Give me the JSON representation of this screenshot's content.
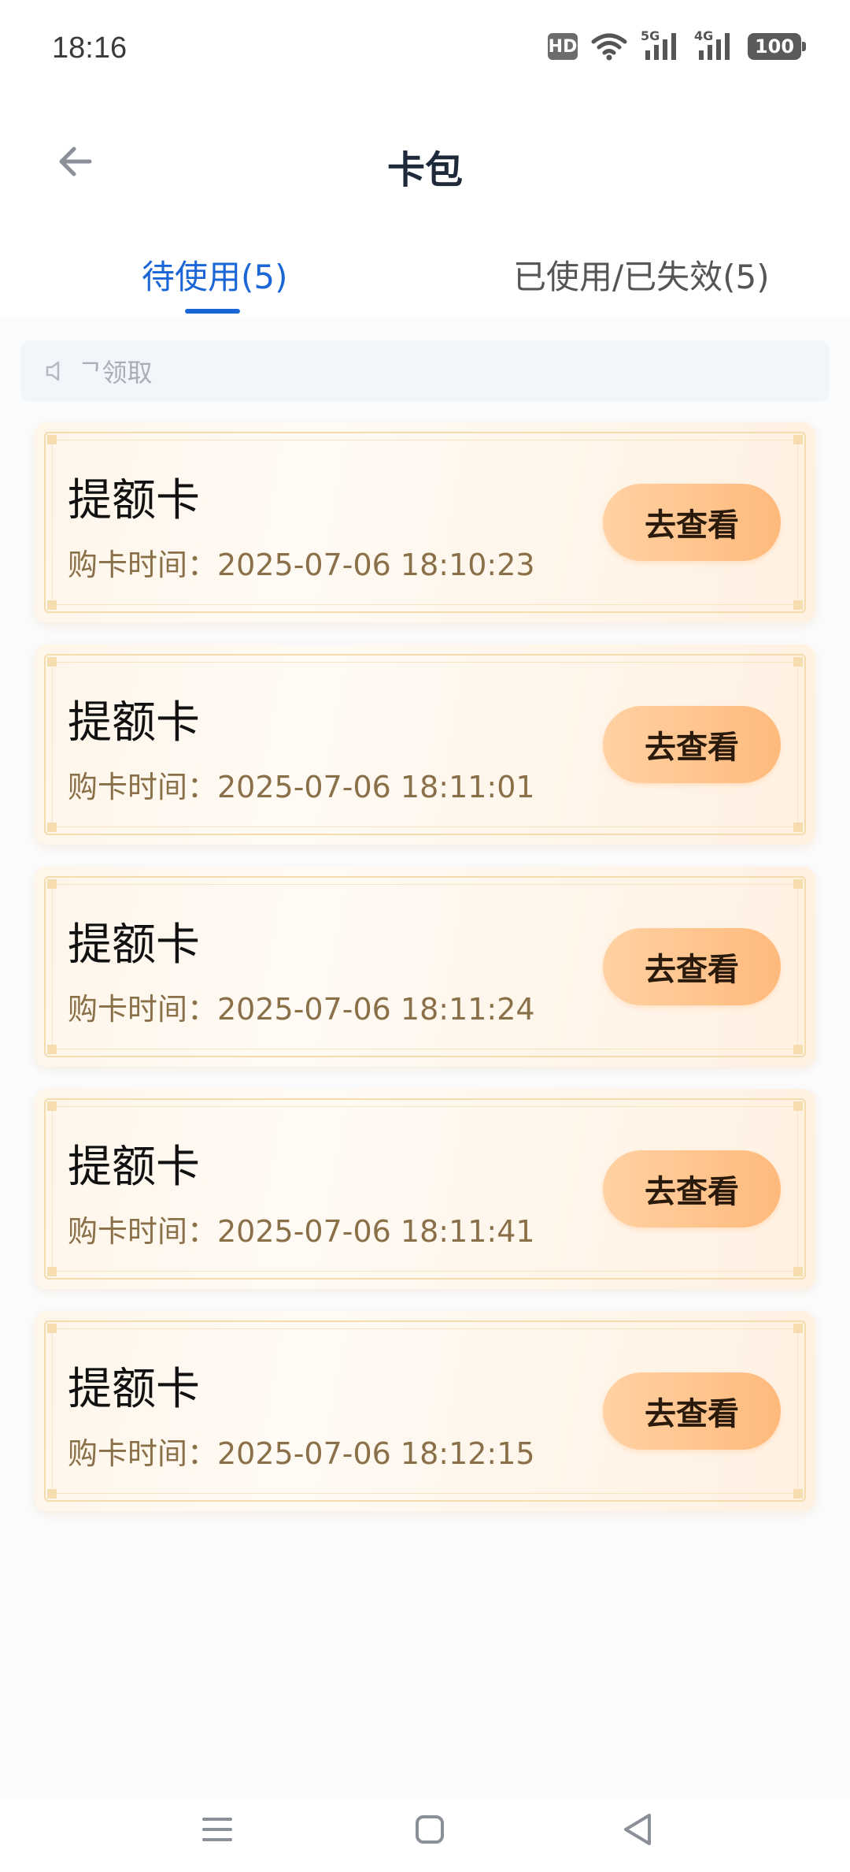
{
  "status_bar": {
    "time": "18:16",
    "hd_label": "HD",
    "network_5g": "5G",
    "network_4g": "4G",
    "battery": "100"
  },
  "header": {
    "title": "卡包"
  },
  "tabs": [
    {
      "label": "待使用(5)",
      "active": true
    },
    {
      "label": "已使用/已失效(5)",
      "active": false
    }
  ],
  "notice": {
    "text": "ᄀ领取"
  },
  "cards": [
    {
      "title": "提额卡",
      "time": "购卡时间：2025-07-06 18:10:23",
      "button": "去查看"
    },
    {
      "title": "提额卡",
      "time": "购卡时间：2025-07-06 18:11:01",
      "button": "去查看"
    },
    {
      "title": "提额卡",
      "time": "购卡时间：2025-07-06 18:11:24",
      "button": "去查看"
    },
    {
      "title": "提额卡",
      "time": "购卡时间：2025-07-06 18:11:41",
      "button": "去查看"
    },
    {
      "title": "提额卡",
      "time": "购卡时间：2025-07-06 18:12:15",
      "button": "去查看"
    }
  ],
  "colors": {
    "accent": "#1a66d6",
    "button_from": "#ffd1a3",
    "button_to": "#ffba7c",
    "time_text": "#8a7048"
  },
  "icons": {
    "back": "arrow-left-icon",
    "notice": "speaker-icon",
    "nav_menu": "menu-icon",
    "nav_home": "home-square-icon",
    "nav_back": "triangle-back-icon"
  }
}
